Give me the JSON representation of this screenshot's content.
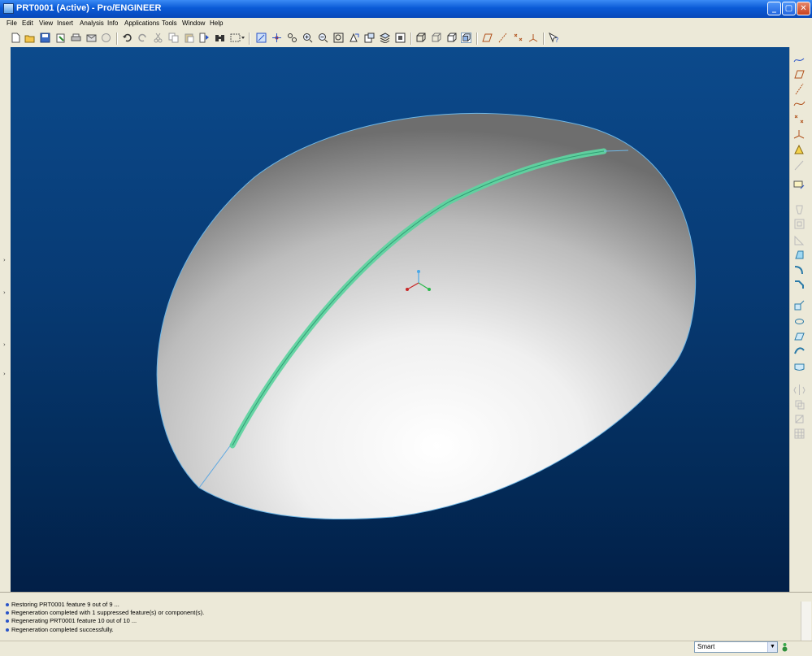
{
  "window": {
    "title": "PRT0001 (Active) - Pro/ENGINEER"
  },
  "menu": [
    {
      "label": "File"
    },
    {
      "label": "Edit"
    },
    {
      "label": "View"
    },
    {
      "label": "Insert"
    },
    {
      "label": "Analysis"
    },
    {
      "label": "Info"
    },
    {
      "label": "Applications"
    },
    {
      "label": "Tools"
    },
    {
      "label": "Window"
    },
    {
      "label": "Help"
    }
  ],
  "toolbar": {
    "icons": [
      "new-icon",
      "open-icon",
      "save-icon",
      "save-copy-icon",
      "print-icon",
      "email-icon",
      "undo-icon",
      "redo-icon",
      "cut-icon",
      "copy-icon",
      "paste-icon",
      "paste-special-icon",
      "regenerate-icon",
      "find-icon",
      "select-box-icon",
      "repaint-icon",
      "spin-center-icon",
      "orient-icon",
      "zoom-in-icon",
      "zoom-out-icon",
      "refit-icon",
      "reorient-icon",
      "saved-views-icon",
      "layers-icon",
      "view-manager-icon",
      "wireframe-icon",
      "hidden-line-icon",
      "no-hidden-icon",
      "shading-icon",
      "datum-planes-icon",
      "datum-axes-icon",
      "datum-points-icon",
      "coord-sys-icon",
      "context-help-icon"
    ]
  },
  "right_toolbar": {
    "icons": [
      "sketch-datum-icon",
      "datum-plane-icon",
      "datum-axis-icon",
      "datum-curve-icon",
      "datum-point-icon",
      "datum-csys-icon",
      "analysis-icon",
      "sketch-icon",
      "hole-icon",
      "shell-icon",
      "rib-icon",
      "draft-icon",
      "round-icon",
      "chamfer-icon",
      "extrude-icon",
      "revolve-icon",
      "sweep-icon",
      "blend-icon",
      "boundary-icon",
      "mirror-icon",
      "merge-icon",
      "trim-icon",
      "pattern-icon"
    ]
  },
  "messages": [
    "Restoring PRT0001 feature 9 out of 9 ...",
    "Regeneration completed with 1 suppressed feature(s) or component(s).",
    "Regenerating PRT0001 feature 10 out of 10 ...",
    "Regeneration completed successfully."
  ],
  "status": {
    "filter": "Smart"
  },
  "colors": {
    "viewport_top": "#0c4a8c",
    "viewport_bottom": "#021f47",
    "highlight": "#5fd3a0",
    "accent_blue": "#0a5ad6"
  }
}
